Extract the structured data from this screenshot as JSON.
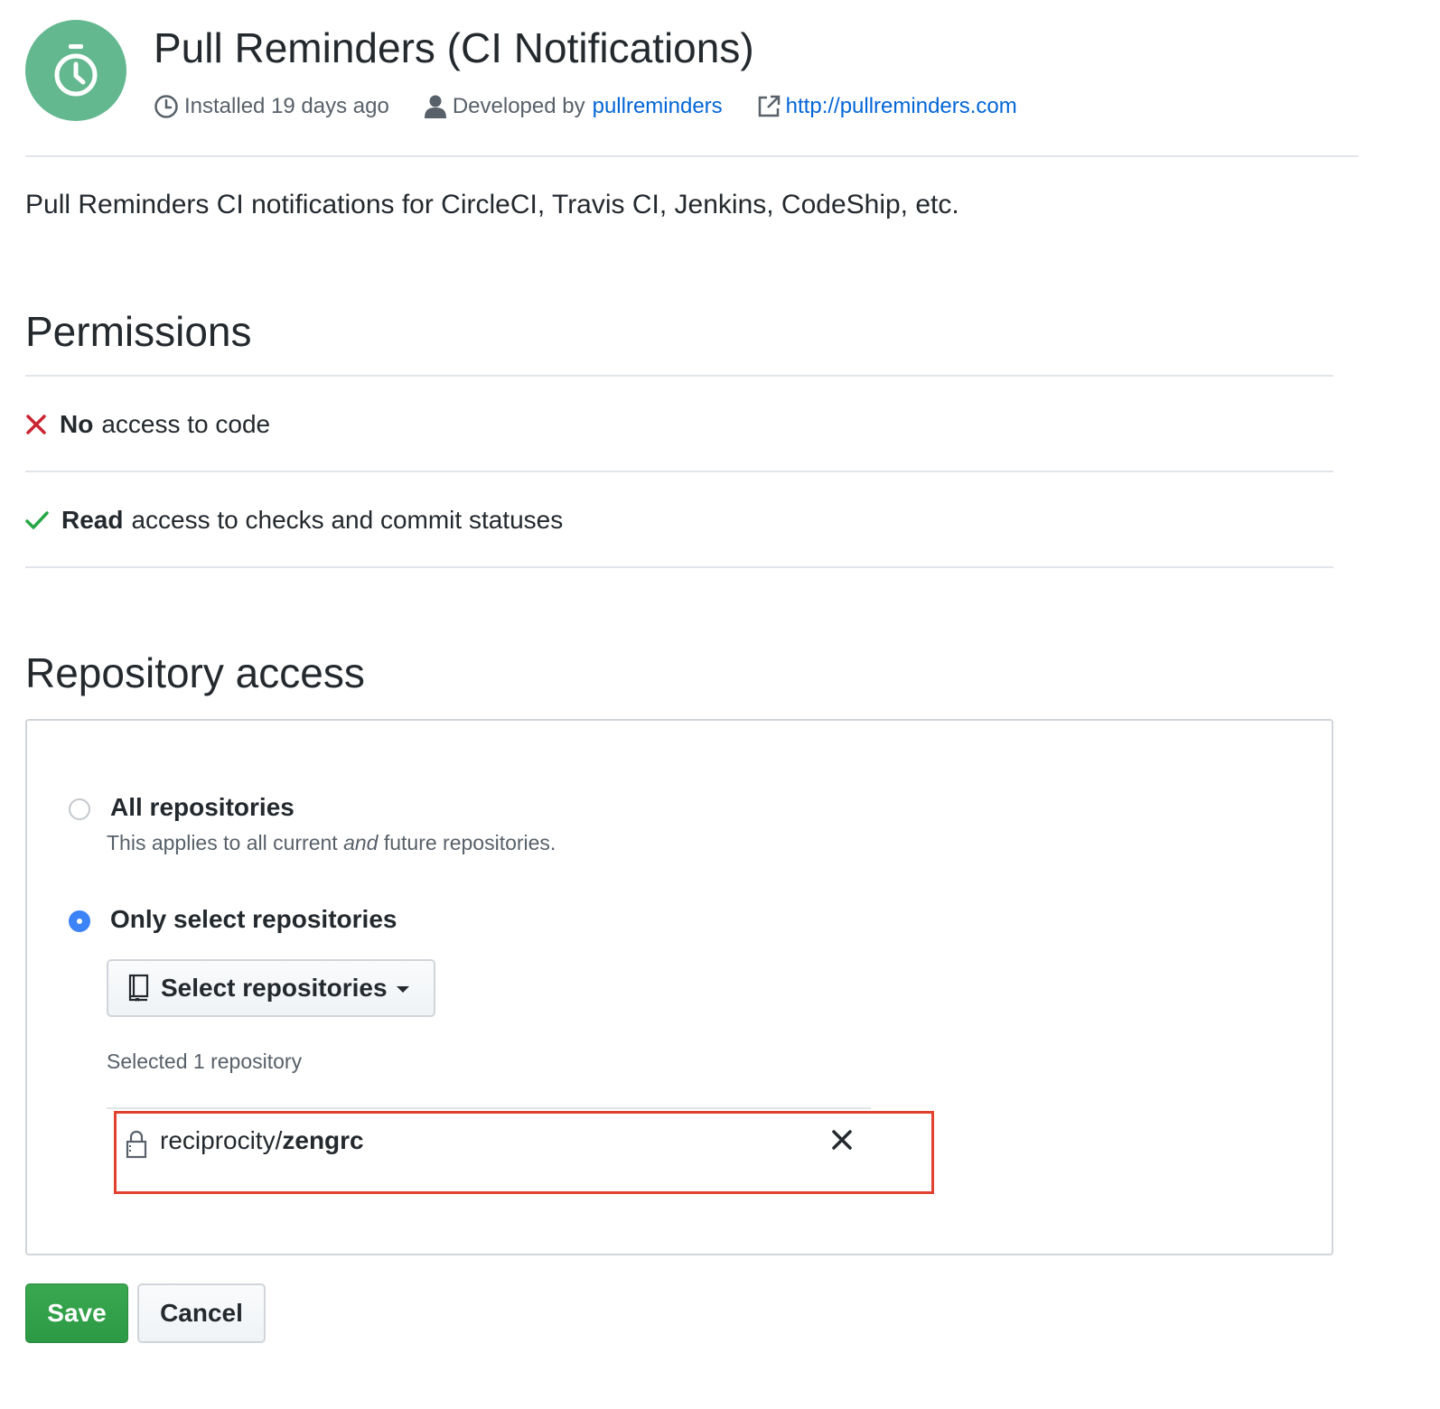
{
  "app": {
    "title": "Pull Reminders (CI Notifications)",
    "avatar_icon": "stopwatch-icon",
    "avatar_color": "#63b88f",
    "installed": "Installed 19 days ago",
    "developed_by_prefix": "Developed by",
    "developer": "pullreminders",
    "website": "http://pullreminders.com",
    "description": "Pull Reminders CI notifications for CircleCI, Travis CI, Jenkins, CodeShip, etc."
  },
  "permissions": {
    "title": "Permissions",
    "items": [
      {
        "icon": "x-icon",
        "strong": "No",
        "text": "access to code",
        "color": "#cb2431"
      },
      {
        "icon": "check-icon",
        "strong": "Read",
        "text": "access to checks and commit statuses",
        "color": "#28a745"
      }
    ]
  },
  "repository_access": {
    "title": "Repository access",
    "all_repos": {
      "label": "All repositories",
      "note_before": "This applies to all current ",
      "note_em": "and",
      "note_after": " future repositories.",
      "selected": false
    },
    "select_repos": {
      "label": "Only select repositories",
      "selected": true
    },
    "select_button": "Select repositories",
    "selected_count": "Selected 1 repository",
    "repos": [
      {
        "owner": "reciprocity/",
        "name": "zengrc",
        "icon": "lock-icon"
      }
    ],
    "highlight_color": "#e2412f"
  },
  "actions": {
    "save": "Save",
    "cancel": "Cancel"
  },
  "colors": {
    "link": "#0366d6",
    "radio_selected": "#3b83f6",
    "save_button": "#2ea44f"
  }
}
